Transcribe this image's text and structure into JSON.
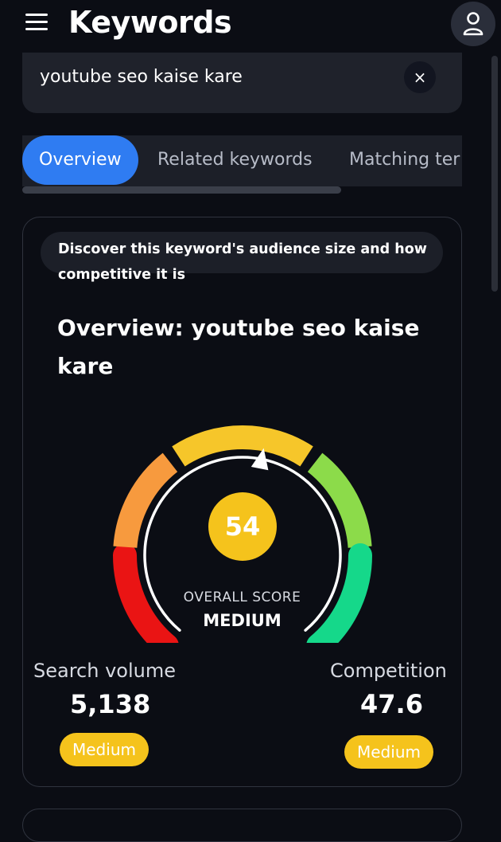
{
  "header": {
    "title": "Keywords"
  },
  "search": {
    "query": "youtube seo kaise kare",
    "clear_symbol": "×"
  },
  "tabs": [
    {
      "label": "Overview",
      "active": true
    },
    {
      "label": "Related keywords",
      "active": false
    },
    {
      "label": "Matching ter",
      "active": false
    }
  ],
  "overview": {
    "description": "Discover this keyword's audience size and how competitive it is",
    "title": "Overview: youtube seo kaise kare",
    "score": "54",
    "score_label": "OVERALL SCORE",
    "score_level": "MEDIUM",
    "score_value": 54,
    "gauge_colors": [
      "#ea1414",
      "#f79a3e",
      "#f6c62a",
      "#8cdb4a",
      "#15d88a"
    ]
  },
  "metrics": {
    "search_volume": {
      "label": "Search volume",
      "value": "5,138",
      "badge": "Medium"
    },
    "competition": {
      "label": "Competition",
      "value": "47.6",
      "badge": "Medium"
    }
  },
  "colors": {
    "accent": "#2f7cf2",
    "badge": "#f5c31c",
    "background": "#0b0d14"
  },
  "icons": {
    "menu": "menu-icon",
    "user": "user-icon",
    "close": "close-icon",
    "pointer": "gauge-pointer-icon"
  }
}
